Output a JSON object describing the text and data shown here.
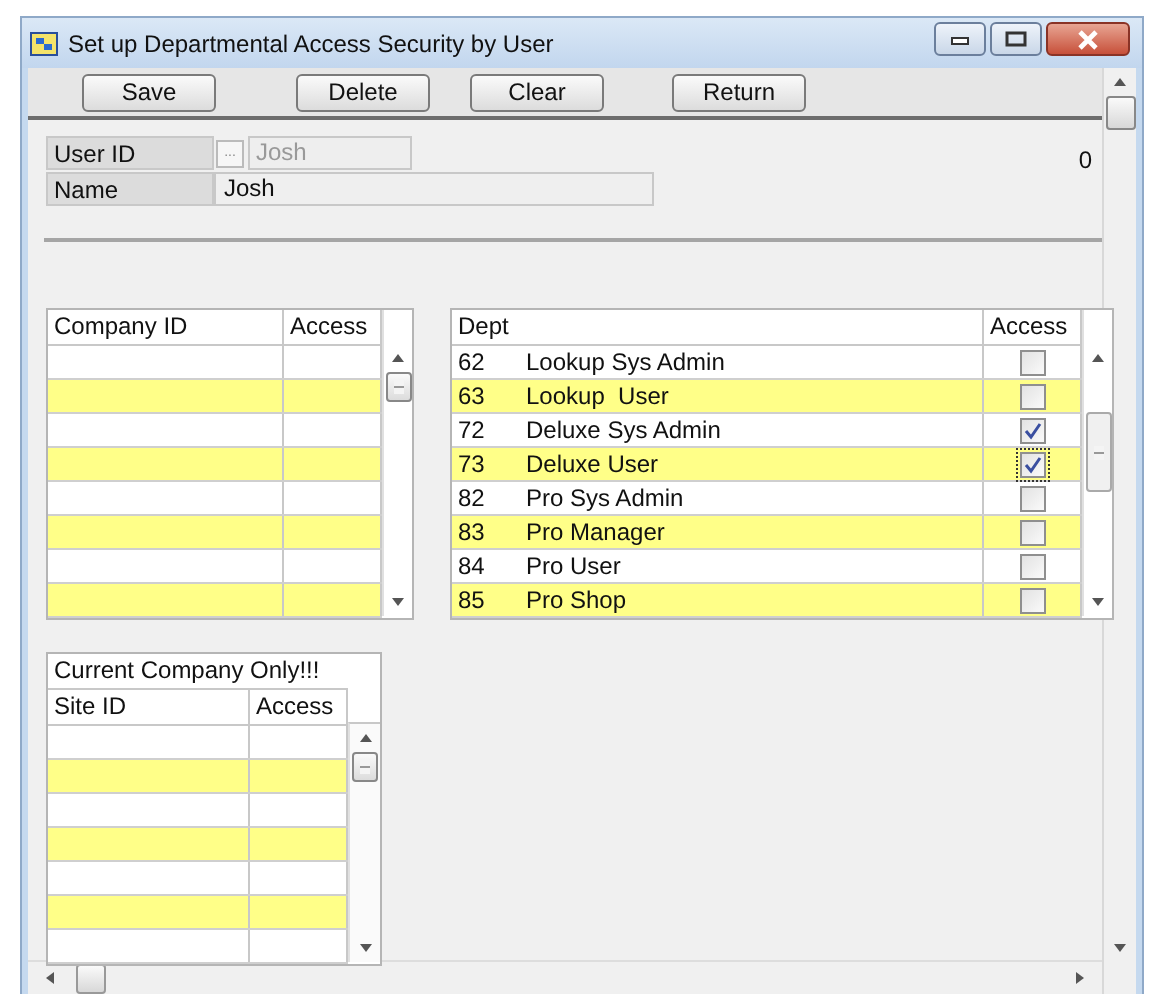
{
  "window": {
    "title": "Set up Departmental Access Security by User"
  },
  "toolbar": {
    "buttons": [
      "Save",
      "Delete",
      "Clear",
      "Return"
    ]
  },
  "user": {
    "user_id_label": "User ID",
    "lookup_button": "...",
    "user_id_value": "Josh",
    "name_label": "Name",
    "name_value": "Josh",
    "count": "0"
  },
  "company_table": {
    "columns": [
      "Company ID",
      "Access"
    ]
  },
  "dept_table": {
    "columns": [
      "Dept",
      "Access"
    ],
    "rows": [
      {
        "id": "62",
        "name": "Lookup Sys Admin",
        "access": false,
        "focused": false
      },
      {
        "id": "63",
        "name": "Lookup  User",
        "access": false,
        "focused": false
      },
      {
        "id": "72",
        "name": "Deluxe Sys Admin",
        "access": true,
        "focused": false
      },
      {
        "id": "73",
        "name": "Deluxe User",
        "access": true,
        "focused": true
      },
      {
        "id": "82",
        "name": "Pro Sys Admin",
        "access": false,
        "focused": false
      },
      {
        "id": "83",
        "name": "Pro Manager",
        "access": false,
        "focused": false
      },
      {
        "id": "84",
        "name": "Pro User",
        "access": false,
        "focused": false
      },
      {
        "id": "85",
        "name": "Pro Shop",
        "access": false,
        "focused": false
      }
    ]
  },
  "site_table": {
    "caption": "Current Company Only!!!",
    "columns": [
      "Site ID",
      "Access"
    ]
  }
}
